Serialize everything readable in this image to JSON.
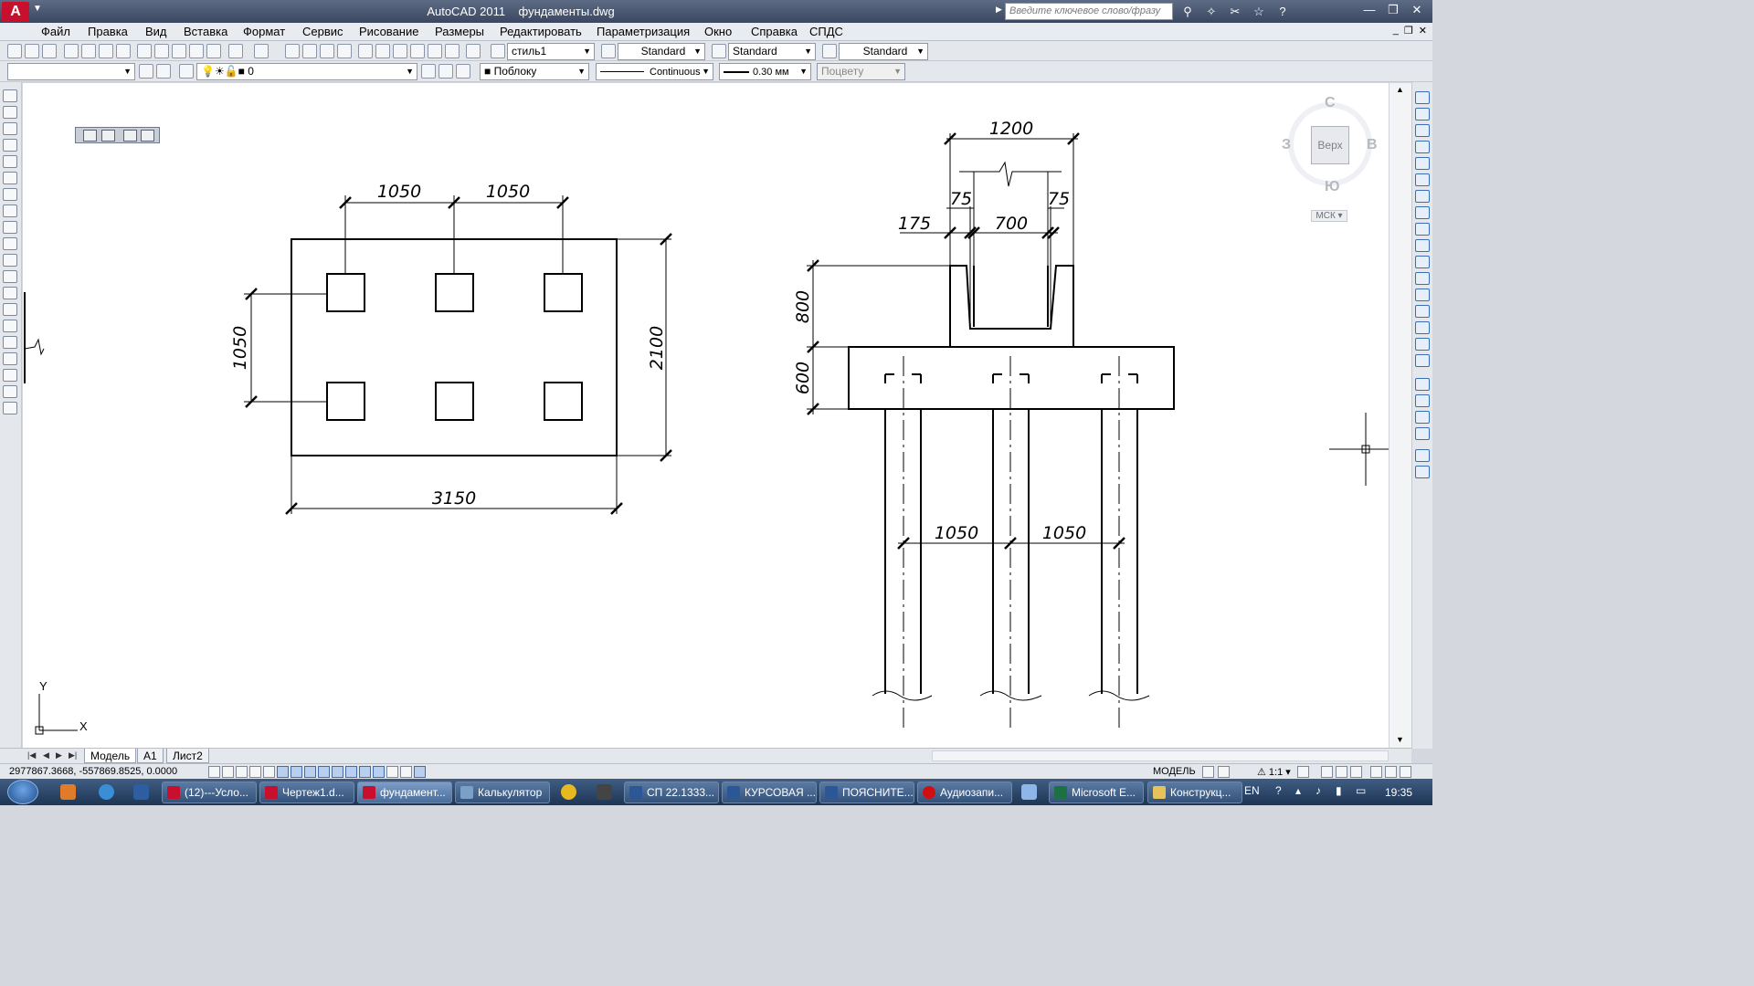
{
  "title_bar": {
    "app_name": "AutoCAD 2011",
    "file_name": "фундаменты.dwg",
    "search_placeholder": "Введите ключевое слово/фразу"
  },
  "menu": [
    "Файл",
    "Правка",
    "Вид",
    "Вставка",
    "Формат",
    "Сервис",
    "Рисование",
    "Размеры",
    "Редактировать",
    "Параметризация",
    "Окно",
    "Справка",
    "СПДС"
  ],
  "toolbar": {
    "text_style": "стиль1",
    "dim_style": "Standard",
    "table_style": "Standard",
    "mleader_style": "Standard",
    "layer": "0",
    "color": "Поблоку",
    "linetype": "Continuous",
    "lineweight": "0.30 мм",
    "plot_style": "Поцвету"
  },
  "viewcube": {
    "north": "С",
    "south": "Ю",
    "west": "З",
    "east": "В",
    "face": "Верх",
    "wcs": "МСК"
  },
  "ucs": {
    "x_label": "X",
    "y_label": "Y"
  },
  "drawing": {
    "plan": {
      "dim_top_1": "1050",
      "dim_top_2": "1050",
      "dim_left": "1050",
      "dim_right": "2100",
      "dim_bottom": "3150"
    },
    "section": {
      "dim_top": "1200",
      "dim_wall_left": "75",
      "dim_wall_right": "75",
      "dim_offset": "175",
      "dim_socket": "700",
      "dim_height_glass": "800",
      "dim_height_slab": "600",
      "dim_piles_1": "1050",
      "dim_piles_2": "1050"
    }
  },
  "layout_tabs": [
    "Модель",
    "А1",
    "Лист2"
  ],
  "status": {
    "coordinates": "2977867.3668, -557869.8525, 0.0000",
    "model": "МОДЕЛЬ",
    "scale": "1:1"
  },
  "taskbar": {
    "tasks": [
      "(12)---Усло...",
      "Чертеж1.d...",
      "фундамент...",
      "Калькулятор",
      "СП 22.1333...",
      "КУРСОВАЯ ...",
      "ПОЯСНИТЕ...",
      "Аудиозапи...",
      "Microsoft E...",
      "Конструкц..."
    ],
    "language": "EN",
    "time": "19:35"
  }
}
